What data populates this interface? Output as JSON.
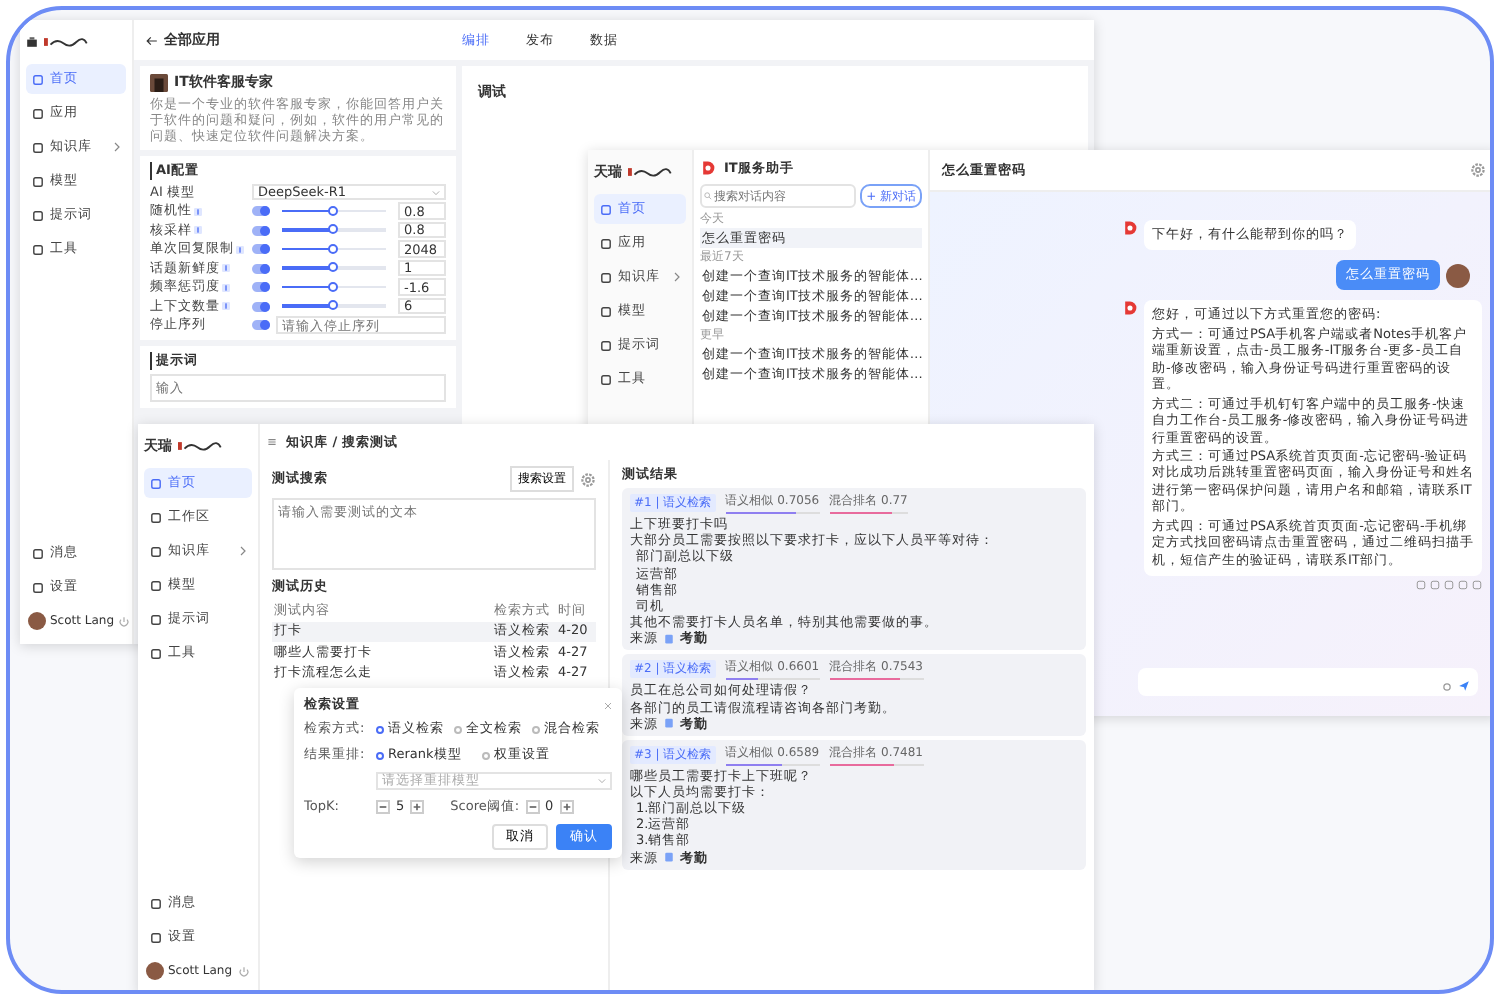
{
  "editor_window": {
    "nav": [
      {
        "label": "首页",
        "selected": true,
        "has_submenu": false
      },
      {
        "label": "应用",
        "selected": false,
        "has_submenu": false
      },
      {
        "label": "知识库",
        "selected": false,
        "has_submenu": true
      },
      {
        "label": "模型",
        "selected": false,
        "has_submenu": false
      },
      {
        "label": "提示词",
        "selected": false,
        "has_submenu": false
      },
      {
        "label": "工具",
        "selected": false,
        "has_submenu": false
      }
    ],
    "bottom_nav": [
      "消息",
      "设置"
    ],
    "user": "Scott Lang",
    "back_label": "全部应用",
    "tabs": [
      {
        "label": "编排",
        "selected": true
      },
      {
        "label": "发布",
        "selected": false
      },
      {
        "label": "数据",
        "selected": false
      }
    ],
    "app": {
      "name": "IT软件客服专家",
      "description": "你是一个专业的软件客服专家，你能回答用户关于软件的问题和疑问，例如，软件的用户常见的问题、快速定位软件问题解决方案。"
    },
    "ai_config": {
      "title": "AI配置",
      "model_label": "AI 模型",
      "model": "DeepSeek-R1",
      "params": [
        {
          "label": "随机性",
          "on": true,
          "level": 0.5,
          "value": "0.8"
        },
        {
          "label": "核采样",
          "on": true,
          "level": 0.5,
          "value": "0.8"
        },
        {
          "label": "单次回复限制",
          "on": true,
          "level": 0.5,
          "value": "2048"
        },
        {
          "label": "话题新鲜度",
          "on": true,
          "level": 0.5,
          "value": "1"
        },
        {
          "label": "频率惩罚度",
          "on": true,
          "level": 0.5,
          "value": "-1.6"
        },
        {
          "label": "上下文数量",
          "on": true,
          "level": 0.5,
          "value": "6"
        }
      ],
      "stop": {
        "label": "停止序列",
        "on": true,
        "placeholder": "请输入停止序列"
      }
    },
    "prompt": {
      "title": "提示词",
      "placeholder": "输入"
    },
    "debug_title": "调试"
  },
  "chat_window": {
    "brand": "天瑞",
    "nav": [
      {
        "label": "首页",
        "selected": true,
        "has_submenu": false
      },
      {
        "label": "应用",
        "selected": false,
        "has_submenu": false
      },
      {
        "label": "知识库",
        "selected": false,
        "has_submenu": true
      },
      {
        "label": "模型",
        "selected": false,
        "has_submenu": false
      },
      {
        "label": "提示词",
        "selected": false,
        "has_submenu": false
      },
      {
        "label": "工具",
        "selected": false,
        "has_submenu": false
      }
    ],
    "assistant": "IT服务助手",
    "search_placeholder": "搜索对话内容",
    "new_button": "+ 新对话",
    "groups": [
      {
        "title": "今天",
        "items": [
          {
            "label": "怎么重置密码",
            "selected": true
          }
        ]
      },
      {
        "title": "最近7天",
        "items": [
          {
            "label": "创建一个查询IT技术服务的智能体…",
            "selected": false
          },
          {
            "label": "创建一个查询IT技术服务的智能体…",
            "selected": false
          },
          {
            "label": "创建一个查询IT技术服务的智能体…",
            "selected": false
          }
        ]
      },
      {
        "title": "更早",
        "items": [
          {
            "label": "创建一个查询IT技术服务的智能体…",
            "selected": false
          },
          {
            "label": "创建一个查询IT技术服务的智能体…",
            "selected": false
          }
        ]
      }
    ],
    "title": "怎么重置密码",
    "messages": [
      {
        "kind": "bot",
        "lines": [
          "下午好，有什么能帮到你的吗？"
        ]
      },
      {
        "kind": "user",
        "lines": [
          "怎么重置密码"
        ]
      },
      {
        "kind": "bot",
        "lines": [
          "您好，可通过以下方式重置您的密码:",
          "方式一：可通过PSA手机客户端或者Notes手机客户端重新设置，点击-员工服务-IT服务台-更多-员工自助-修改密码，输入身份证号码进行重置密码的设置。",
          "方式二：可通过手机钉钉客户端中的员工服务-快速自力工作台-员工服务-修改密码，输入身份证号码进行重置密码的设置。",
          "方式三：可通过PSA系统首页页面-忘记密码-验证码对比成功后跳转重置密码页面，输入身份证号和姓名进行第一密码保护问题，请用户名和邮箱，请联系IT部门。",
          "方式四：可通过PSA系统首页页面-忘记密码-手机绑定方式找回密码请点击重置密码，通过二维码扫描手机，短信产生的验证码，请联系IT部门。"
        ]
      }
    ]
  },
  "search_window": {
    "brand": "天瑞",
    "nav": [
      {
        "label": "首页",
        "selected": true,
        "has_submenu": false
      },
      {
        "label": "工作区",
        "selected": false,
        "has_submenu": false
      },
      {
        "label": "知识库",
        "selected": false,
        "has_submenu": true
      },
      {
        "label": "模型",
        "selected": false,
        "has_submenu": false
      },
      {
        "label": "提示词",
        "selected": false,
        "has_submenu": false
      },
      {
        "label": "工具",
        "selected": false,
        "has_submenu": false
      }
    ],
    "bottom_nav": [
      "消息",
      "设置"
    ],
    "user": "Scott Lang",
    "breadcrumb": "知识库 / 搜索测试",
    "test_title": "测试搜索",
    "settings_button": "搜索设置",
    "test_placeholder": "请输入需要测试的文本",
    "history_title": "测试历史",
    "columns": [
      "测试内容",
      "检索方式",
      "时间"
    ],
    "rows": [
      {
        "cells": [
          "打卡",
          "语义检索",
          "4-20"
        ],
        "selected": true
      },
      {
        "cells": [
          "哪些人需要打卡",
          "语义检索",
          "4-27"
        ],
        "selected": false
      },
      {
        "cells": [
          "打卡流程怎么走",
          "语义检索",
          "4-27"
        ],
        "selected": false
      }
    ],
    "dialog": {
      "title": "检索设置",
      "method_label": "检索方式:",
      "methods": [
        {
          "label": "语义检索",
          "selected": true
        },
        {
          "label": "全文检索",
          "selected": false
        },
        {
          "label": "混合检索",
          "selected": false
        }
      ],
      "rerank_label": "结果重排:",
      "rerank": [
        {
          "label": "Rerank模型",
          "selected": true
        },
        {
          "label": "权重设置",
          "selected": false
        }
      ],
      "model_placeholder": "请选择重排模型",
      "topk_label": "TopK:",
      "topk": "5",
      "score_label": "Score阈值:",
      "score": "0",
      "cancel": "取消",
      "confirm": "确认"
    },
    "results_title": "测试结果",
    "cards": [
      {
        "rank": "#1 | 语义检索",
        "scores": [
          {
            "label": "语义相似 0.7056",
            "level": 0.75,
            "color": "#8f7ff0"
          },
          {
            "label": "混合排名 0.77",
            "level": 0.8,
            "color": "#e86b9d"
          }
        ],
        "lines": [
          "上下班要打卡吗",
          "大部分员工需要按照以下要求打卡，应以下人员平等对待："
        ],
        "bullets": [
          "部门副总以下级",
          "运营部",
          "销售部",
          "司机"
        ],
        "note": "其他不需要打卡人员名单，特别其他需要做的事。",
        "source_label": "来源",
        "source": "考勤"
      },
      {
        "rank": "#2 | 语义检索",
        "scores": [
          {
            "label": "语义相似 0.6601",
            "level": 0.35,
            "color": "#8f7ff0"
          },
          {
            "label": "混合排名 0.7543",
            "level": 0.75,
            "color": "#e86b9d"
          }
        ],
        "lines": [
          "员工在总公司如何处理请假？",
          "各部门的员工请假流程请咨询各部门考勤。"
        ],
        "source_label": "来源",
        "source": "考勤"
      },
      {
        "rank": "#3 | 语义检索",
        "scores": [
          {
            "label": "语义相似 0.6589",
            "level": 0.6,
            "color": "#8f7ff0"
          },
          {
            "label": "混合排名 0.7481",
            "level": 0.7,
            "color": "#e86b9d"
          }
        ],
        "lines": [
          "哪些员工需要打卡上下班呢？",
          "以下人员均需要打卡："
        ],
        "bullets": [
          "1.部门副总以下级",
          "2.运营部",
          "3.销售部"
        ],
        "source_label": "来源",
        "source": "考勤"
      }
    ]
  }
}
